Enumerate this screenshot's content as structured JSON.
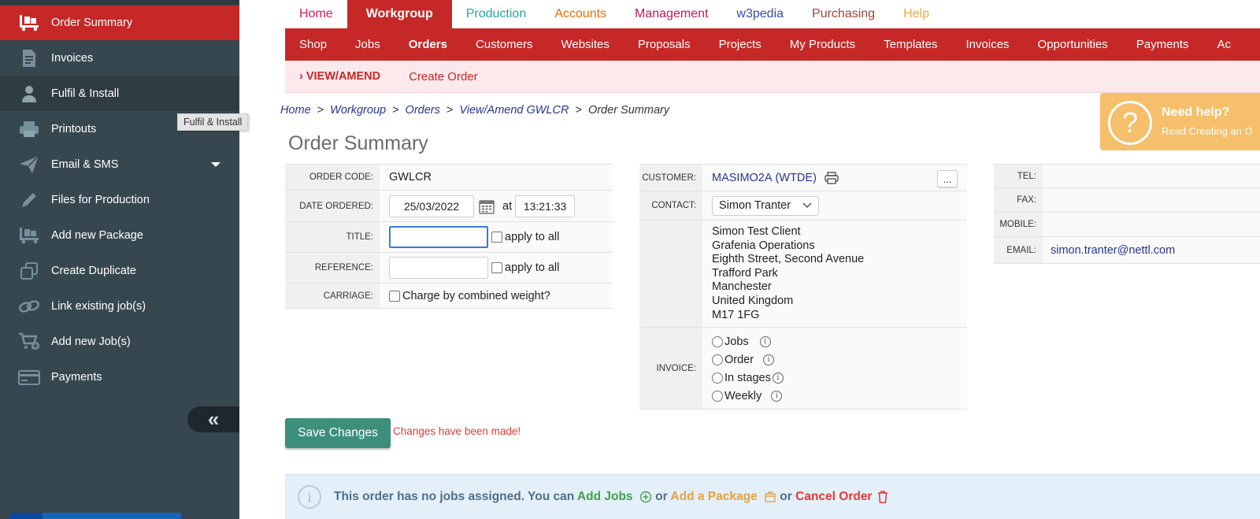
{
  "colors": {
    "accent_red": "#c62828",
    "sidebar_bg": "#37474f",
    "save_green": "#3d8f7b",
    "help_orange": "#f6bf6b"
  },
  "sidebar": {
    "items": [
      {
        "label": "Order Summary",
        "icon": "pallet-truck-icon"
      },
      {
        "label": "Invoices",
        "icon": "document-icon"
      },
      {
        "label": "Fulfil & Install",
        "icon": "person-icon"
      },
      {
        "label": "Printouts",
        "icon": "printer-icon"
      },
      {
        "label": "Email & SMS",
        "icon": "paper-plane-icon"
      },
      {
        "label": "Files for Production",
        "icon": "pencil-icon"
      },
      {
        "label": "Add new Package",
        "icon": "package-icon"
      },
      {
        "label": "Create Duplicate",
        "icon": "duplicate-icon"
      },
      {
        "label": "Link existing job(s)",
        "icon": "link-icon"
      },
      {
        "label": "Add new Job(s)",
        "icon": "cart-add-icon"
      },
      {
        "label": "Payments",
        "icon": "credit-card-icon"
      }
    ],
    "collapse_label": "«",
    "tooltip": "Fulfil & Install"
  },
  "topnav": {
    "tabs": [
      {
        "label": "Home",
        "color": "#d81b60"
      },
      {
        "label": "Workgroup",
        "color": "#ffffff"
      },
      {
        "label": "Production",
        "color": "#26a69a"
      },
      {
        "label": "Accounts",
        "color": "#ef6c00"
      },
      {
        "label": "Management",
        "color": "#c2185b"
      },
      {
        "label": "w3pedia",
        "color": "#3949ab"
      },
      {
        "label": "Purchasing",
        "color": "#a1453c"
      },
      {
        "label": "Help",
        "color": "#f2a93b"
      }
    ]
  },
  "subnav": {
    "items": [
      "Shop",
      "Jobs",
      "Orders",
      "Customers",
      "Websites",
      "Proposals",
      "Projects",
      "My Products",
      "Templates",
      "Invoices",
      "Opportunities",
      "Payments",
      "Ac"
    ]
  },
  "actionbar": {
    "view_amend": "› VIEW/AMEND",
    "create_order": "Create Order"
  },
  "breadcrumb": {
    "home": "Home",
    "workgroup": "Workgroup",
    "orders": "Orders",
    "view_amend": "View/Amend GWLCR",
    "current": "Order Summary",
    "sep": ">"
  },
  "help": {
    "icon_glyph": "?",
    "title": "Need help?",
    "subtitle": "Read Creating an O"
  },
  "page_title": "Order Summary",
  "order": {
    "order_code_label": "ORDER CODE:",
    "order_code": "GWLCR",
    "date_label": "DATE ORDERED:",
    "date": "25/03/2022",
    "at": "at",
    "time": "13:21:33",
    "title_label": "TITLE:",
    "title_value": "",
    "reference_label": "REFERENCE:",
    "reference_value": "",
    "apply_to_all": "apply to all",
    "carriage_label": "CARRIAGE:",
    "carriage_text": "Charge by combined weight?"
  },
  "customer": {
    "customer_label": "CUSTOMER:",
    "customer_code": "MASIMO2A",
    "customer_sub": "WTDE",
    "ellipsis": "...",
    "contact_label": "CONTACT:",
    "contact_selected": "Simon Tranter",
    "address": [
      "Simon Test Client",
      "Grafenia Operations",
      "Eighth Street, Second Avenue",
      "Trafford Park",
      "Manchester",
      "United Kingdom",
      "M17 1FG"
    ],
    "invoice_label": "INVOICE:",
    "invoice_options": [
      "Jobs",
      "Order",
      "In stages",
      "Weekly"
    ]
  },
  "contact_info": {
    "tel_label": "TEL:",
    "tel": "",
    "fax_label": "FAX:",
    "fax": "",
    "mobile_label": "MOBILE:",
    "mobile": "",
    "email_label": "EMAIL:",
    "email": "simon.tranter@nettl.com"
  },
  "save_button": "Save Changes",
  "changes_msg": "Changes have been made!",
  "notice": {
    "text1": "This order has no jobs assigned. You can ",
    "add_jobs": "Add Jobs",
    "or1": " or ",
    "add_package": "Add a Package",
    "or2": " or ",
    "cancel_order": "Cancel Order"
  }
}
